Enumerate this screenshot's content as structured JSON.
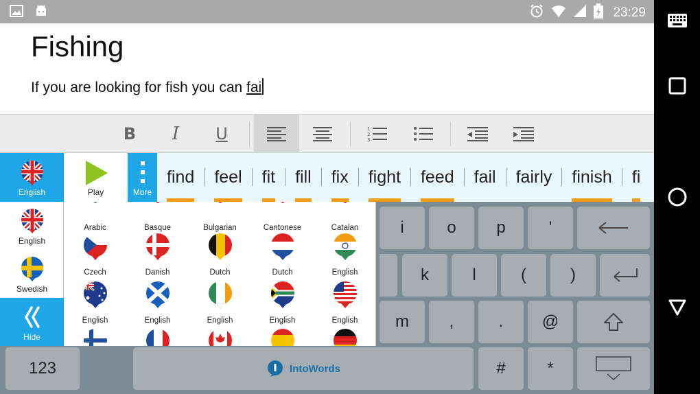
{
  "status_bar": {
    "time": "23:29"
  },
  "document": {
    "title": "Fishing",
    "text_before": "If you are looking for fish you can ",
    "current_word": "fai"
  },
  "prediction_bar": {
    "language_label": "English",
    "play_label": "Play",
    "more_label": "More",
    "words": [
      "find",
      "feel",
      "fit",
      "fill",
      "fix",
      "fight",
      "feed",
      "fail",
      "fairly",
      "finish",
      "fi"
    ]
  },
  "language_panel": {
    "side": [
      {
        "label": "English",
        "flag": "uk"
      },
      {
        "label": "Swedish",
        "flag": "sweden"
      },
      {
        "label": "Hide",
        "icon": "chevron-left-double-icon"
      }
    ],
    "row1": [
      "Arabic",
      "Basque",
      "Bulgarian",
      "Cantonese",
      "Catalan"
    ],
    "row2": [
      {
        "label": "Czech",
        "flag": "czech"
      },
      {
        "label": "Danish",
        "flag": "denmark"
      },
      {
        "label": "Dutch",
        "flag": "belgium"
      },
      {
        "label": "Dutch",
        "flag": "netherlands"
      },
      {
        "label": "English",
        "flag": "india"
      }
    ],
    "row3": [
      {
        "label": "English",
        "flag": "australia"
      },
      {
        "label": "English",
        "flag": "scotland"
      },
      {
        "label": "English",
        "flag": "ireland"
      },
      {
        "label": "English",
        "flag": "south-africa"
      },
      {
        "label": "English",
        "flag": "usa"
      }
    ],
    "row4_flags": [
      "finland",
      "france",
      "canada",
      "spain",
      "germany"
    ]
  },
  "keyboard": {
    "row1": [
      "i",
      "o",
      "p",
      "'"
    ],
    "row2": [
      "k",
      "l",
      "(",
      ")"
    ],
    "row3": [
      "m",
      ",",
      ".",
      "@"
    ],
    "row4": {
      "numbers": "123",
      "space_brand": "IntoWords",
      "hash": "#",
      "star": "*"
    }
  },
  "colors": {
    "accent": "#1ea6e6",
    "prediction_underline": "#f39c12",
    "keyboard_bg": "#7d8b94",
    "key": "#a6aeb4"
  }
}
